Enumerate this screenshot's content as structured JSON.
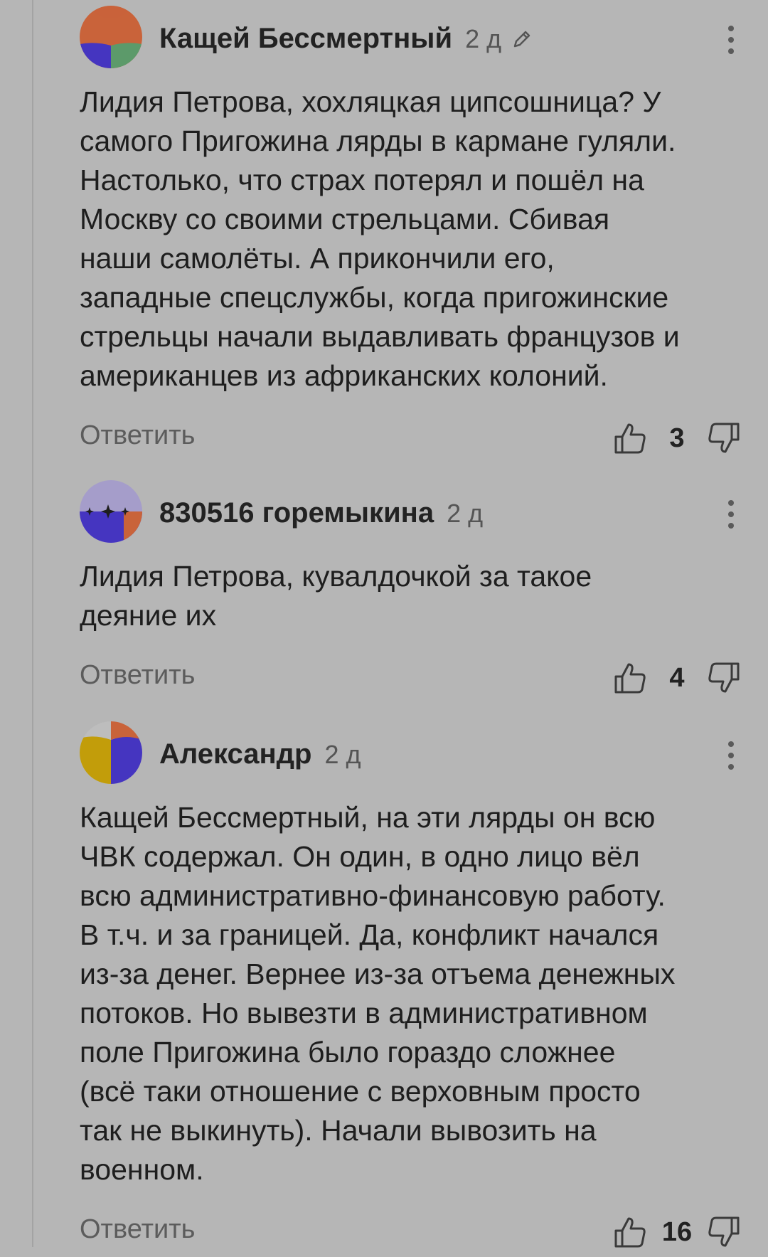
{
  "comments": [
    {
      "author": "Кащей Бессмертный",
      "time": "2 д",
      "edited": true,
      "avatar_colors": [
        "#c9633a",
        "#4535c0",
        "#5c9a6a"
      ],
      "lines": [
        "Лидия Петрова, хохляцкая ципсошница? У",
        "самого Пригожина лярды в кармане гуляли.",
        "Настолько, что страх потерял и пошёл на",
        "Москву со своими стрельцами. Сбивая",
        "наши самолёты. А прикончили его,",
        "западные спецслужбы, когда пригожинские",
        "стрельцы начали выдавливать французов и",
        "американцев из африканских колоний."
      ],
      "reply_label": "Ответить",
      "likes": "3"
    },
    {
      "author": "830516 горемыкина",
      "time": "2 д",
      "edited": false,
      "avatar_colors": [
        "#a59dca",
        "#4535c0",
        "#c9633a",
        "#1e1e1e"
      ],
      "lines": [
        "Лидия Петрова, кувалдочкой за такое",
        "деяние их"
      ],
      "reply_label": "Ответить",
      "likes": "4"
    },
    {
      "author": "Александр",
      "time": "2 д",
      "edited": false,
      "avatar_colors": [
        "#c29d0a",
        "#4535c0",
        "#c9633a",
        "#bdbdbd"
      ],
      "lines": [
        "Кащей Бессмертный, на эти лярды он всю",
        "ЧВК содержал. Он один, в одно лицо вёл",
        "всю административно-финансовую работу.",
        "В т.ч. и за границей. Да, конфликт начался",
        "из-за денег. Вернее из-за отъема денежных",
        "потоков. Но вывезти в административном",
        "поле Пригожина было гораздо сложнее",
        "(всё таки отношение с верховным просто",
        "так не выкинуть). Начали вывозить на",
        "военном."
      ],
      "reply_label": "Ответить",
      "likes": "16"
    }
  ],
  "icons": {
    "like": "thumbs-up-icon",
    "dislike": "thumbs-down-icon",
    "more": "more-vertical-icon",
    "edit": "pencil-icon"
  }
}
